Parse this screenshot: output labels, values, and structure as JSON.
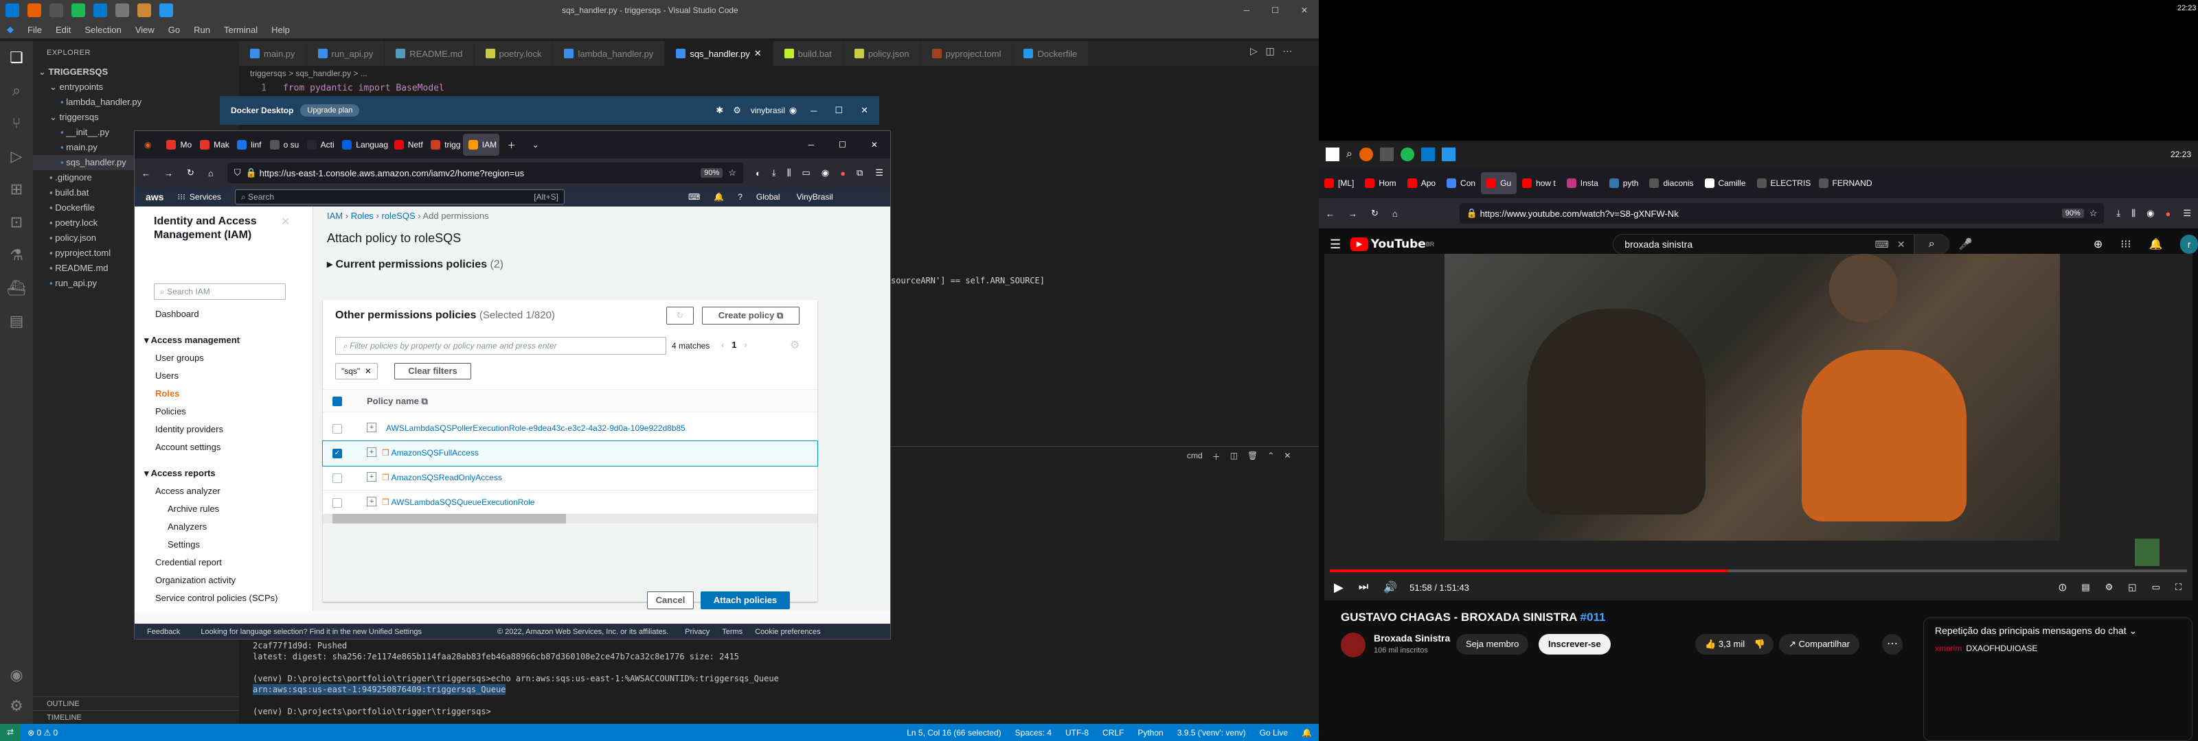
{
  "vscode": {
    "title": "sqs_handler.py - triggersqs - Visual Studio Code",
    "menu": [
      "File",
      "Edit",
      "Selection",
      "View",
      "Go",
      "Run",
      "Terminal",
      "Help"
    ],
    "explorer_title": "EXPLORER",
    "tree": [
      {
        "label": "TRIGGERSQS",
        "indent": 0,
        "type": "root"
      },
      {
        "label": "entrypoints",
        "indent": 1,
        "type": "folder"
      },
      {
        "label": "lambda_handler.py",
        "indent": 2,
        "type": "py"
      },
      {
        "label": "triggersqs",
        "indent": 1,
        "type": "folder"
      },
      {
        "label": "__init__.py",
        "indent": 2,
        "type": "py"
      },
      {
        "label": "main.py",
        "indent": 2,
        "type": "py"
      },
      {
        "label": "sqs_handler.py",
        "indent": 2,
        "type": "py",
        "active": true
      },
      {
        "label": ".gitignore",
        "indent": 1,
        "type": "file"
      },
      {
        "label": "build.bat",
        "indent": 1,
        "type": "file"
      },
      {
        "label": "Dockerfile",
        "indent": 1,
        "type": "file"
      },
      {
        "label": "poetry.lock",
        "indent": 1,
        "type": "file"
      },
      {
        "label": "policy.json",
        "indent": 1,
        "type": "file"
      },
      {
        "label": "pyproject.toml",
        "indent": 1,
        "type": "file"
      },
      {
        "label": "README.md",
        "indent": 1,
        "type": "file"
      },
      {
        "label": "run_api.py",
        "indent": 1,
        "type": "py"
      }
    ],
    "outline": "OUTLINE",
    "timeline": "TIMELINE",
    "tabs": [
      "main.py",
      "run_api.py",
      "README.md",
      "poetry.lock",
      "lambda_handler.py",
      "sqs_handler.py",
      "build.bat",
      "policy.json",
      "pyproject.toml",
      "Dockerfile"
    ],
    "active_tab": "sqs_handler.py",
    "breadcrumb": "triggersqs > sqs_handler.py > ...",
    "code_line1_no": "1",
    "code_line1": "from pydantic import BaseModel",
    "code_fragment": "sourceARN'] == self.ARN_SOURCE]",
    "terminal_label": "cmd",
    "terminal_lines": [
      "2caf77f1d9d: Pushed",
      "latest: digest: sha256:7e1174e865b114faa28ab83feb46a88966cb87d360108e2ce47b7ca32c8e1776 size: 2415",
      "",
      "(venv) D:\\projects\\portfolio\\trigger\\triggersqs>echo arn:aws:sqs:us-east-1:%AWSACCOUNTID%:triggersqs_Queue",
      "arn:aws:sqs:us-east-1:949250876409:triggersqs_Queue",
      "",
      "(venv) D:\\projects\\portfolio\\trigger\\triggersqs>"
    ],
    "status_left": [
      "⊗ 0 ⚠ 0"
    ],
    "status_right": [
      "Ln 5, Col 16 (66 selected)",
      "Spaces: 4",
      "UTF-8",
      "CRLF",
      "Python",
      "3.9.5 ('venv': venv)",
      "Go Live"
    ]
  },
  "docker": {
    "title": "Docker Desktop",
    "upgrade": "Upgrade plan",
    "user": "vinybrasil"
  },
  "firefox": {
    "tabs": [
      "Mo",
      "Mak",
      "linf",
      "o su",
      "Acti",
      "Languag",
      "Netf",
      "trigg",
      "IAM"
    ],
    "url": "https://us-east-1.console.aws.amazon.com/iamv2/home?region=us",
    "zoom": "90%"
  },
  "aws": {
    "services": "Services",
    "search_placeholder": "Search",
    "search_hint": "[Alt+S]",
    "region": "Global",
    "account": "VinyBrasil",
    "side_title": "Identity and Access Management (IAM)",
    "side_search": "Search IAM",
    "dashboard": "Dashboard",
    "access_management": "Access management",
    "am_items": [
      "User groups",
      "Users",
      "Roles",
      "Policies",
      "Identity providers",
      "Account settings"
    ],
    "access_reports": "Access reports",
    "ar_items": [
      "Access analyzer",
      "Archive rules",
      "Analyzers",
      "Settings",
      "Credential report",
      "Organization activity",
      "Service control policies (SCPs)"
    ],
    "breadcrumb": [
      "IAM",
      "Roles",
      "roleSQS",
      "Add permissions"
    ],
    "heading": "Attach policy to roleSQS",
    "current_policies": "Current permissions policies",
    "current_count": "(2)",
    "other_title": "Other permissions policies",
    "other_selected": "(Selected 1/820)",
    "create_policy": "Create policy",
    "filter_placeholder": "Filter policies by property or policy name and press enter",
    "matches": "4 matches",
    "page": "1",
    "filter_chip": "\"sqs\"",
    "clear_filters": "Clear filters",
    "col_policy": "Policy name",
    "rows": [
      {
        "name": "AWSLambdaSQSPollerExecutionRole-e9dea43c-e3c2-4a32-9d0a-109e922d8b85",
        "checked": false,
        "aws": false
      },
      {
        "name": "AmazonSQSFullAccess",
        "checked": true,
        "aws": true
      },
      {
        "name": "AmazonSQSReadOnlyAccess",
        "checked": false,
        "aws": true
      },
      {
        "name": "AWSLambdaSQSQueueExecutionRole",
        "checked": false,
        "aws": true
      }
    ],
    "cancel": "Cancel",
    "attach": "Attach policies",
    "footer_feedback": "Feedback",
    "footer_lang": "Looking for language selection? Find it in the new Unified Settings",
    "footer_copy": "© 2022, Amazon Web Services, Inc. or its affiliates.",
    "footer_links": [
      "Privacy",
      "Terms",
      "Cookie preferences"
    ]
  },
  "youtube": {
    "clock_top": "22:23",
    "clock_second": "22:23",
    "tabs": [
      "[ML]",
      "Hom",
      "Apo",
      "Con",
      "Gu",
      "how t",
      "Insta",
      "pyth",
      "diaconis",
      "Camille",
      "ELECTRIS",
      "FERNAND"
    ],
    "url": "https://www.youtube.com/watch?v=S8-gXNFW-Nk",
    "zoom": "90%",
    "search": "broxada sinistra",
    "logo": "YouTube",
    "logo_sup": "BR",
    "avatar": "r",
    "time": "51:58 / 1:51:43",
    "title": "GUSTAVO CHAGAS - BROXADA SINISTRA",
    "episode": "#011",
    "channel": "Broxada Sinistra",
    "subs": "106 mil inscritos",
    "join": "Seja membro",
    "subscribe": "Inscrever-se",
    "likes": "3,3 mil",
    "share": "Compartilhar",
    "chat_title": "Repetição das principais mensagens do chat",
    "chat_user": "xmorim",
    "chat_msg": "DXAOFHDUIOASE",
    "progress": 0.465
  }
}
